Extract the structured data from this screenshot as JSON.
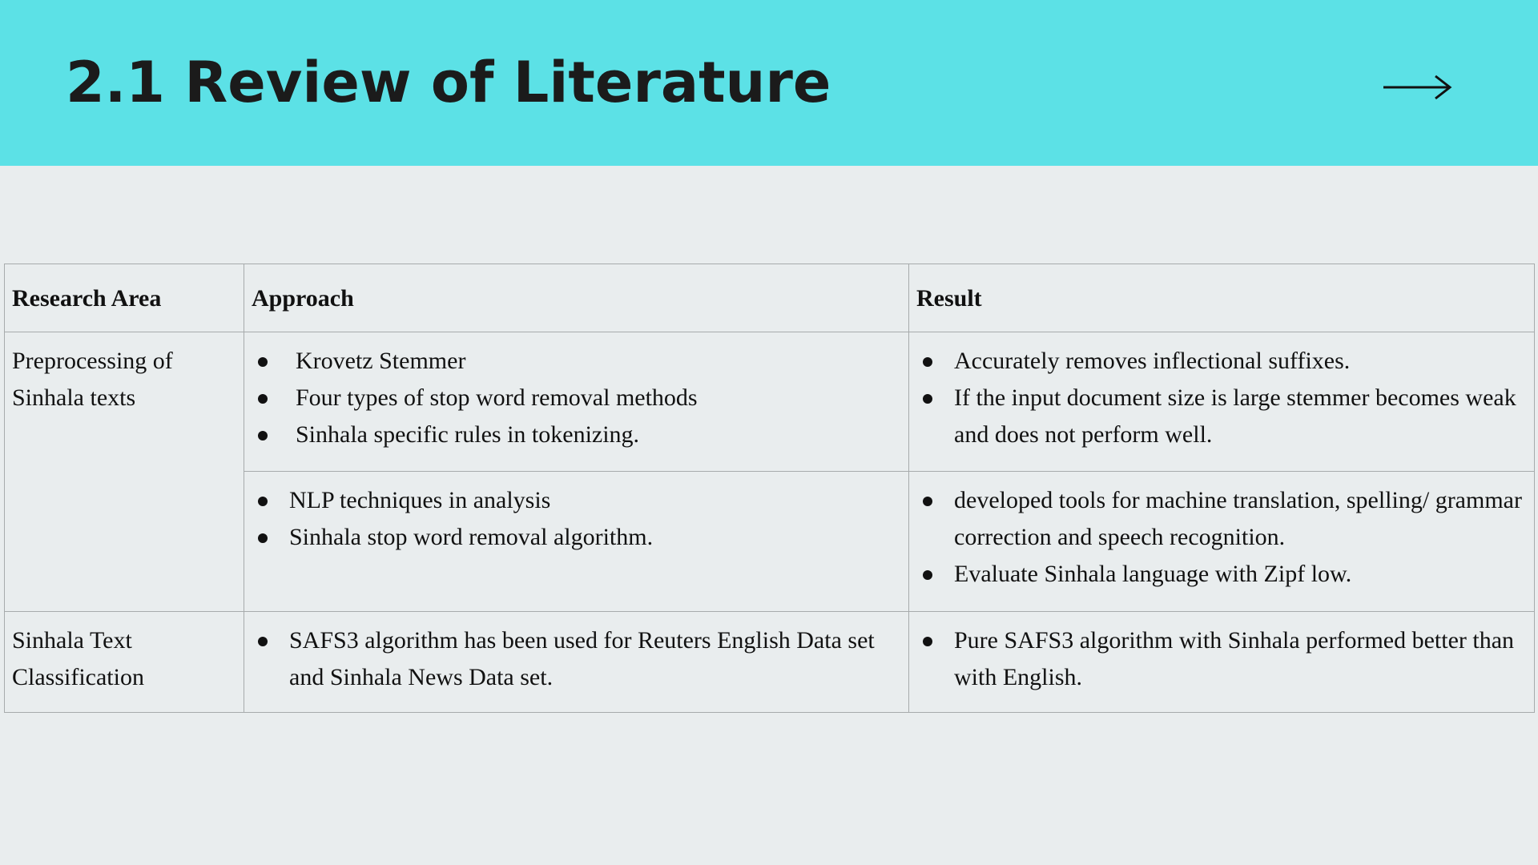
{
  "slide": {
    "title": "2.1 Review of Literature",
    "next_icon": "arrow-right-icon"
  },
  "colors": {
    "header_bg": "#5ce1e6",
    "page_bg": "#e9edee",
    "border": "#a7abac"
  },
  "table": {
    "headers": [
      "Research Area",
      "Approach",
      "Result"
    ],
    "rows": [
      {
        "area": "Preprocessing of Sinhala texts",
        "approach": [
          "Krovetz Stemmer",
          "Four types of stop word removal methods",
          "Sinhala specific rules in tokenizing."
        ],
        "result": [
          "Accurately removes inflectional suffixes.",
          "If the input document size is large stemmer becomes weak and does not perform well."
        ]
      },
      {
        "area": "",
        "approach": [
          "NLP techniques in analysis",
          "Sinhala stop word removal algorithm."
        ],
        "result": [
          "developed tools for machine translation, spelling/ grammar correction and speech recognition.",
          "Evaluate Sinhala language with Zipf low."
        ]
      },
      {
        "area": "Sinhala Text Classification",
        "approach": [
          "SAFS3 algorithm has been used for Reuters English Data set and Sinhala News Data set."
        ],
        "result": [
          "Pure SAFS3 algorithm with Sinhala performed better than with English."
        ]
      }
    ]
  }
}
